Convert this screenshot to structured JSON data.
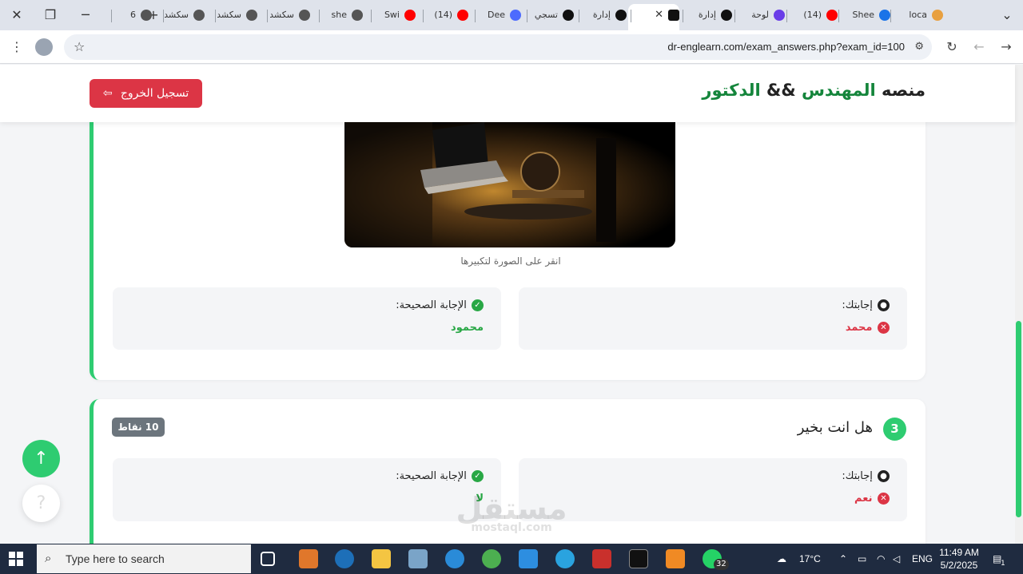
{
  "browser": {
    "tabs": [
      {
        "label": "loca",
        "color": "#e8a040"
      },
      {
        "label": "Shee",
        "color": "#1a73e8"
      },
      {
        "label": "(14)",
        "color": "#ff0000"
      },
      {
        "label": "لوحة",
        "color": "#6a3de8"
      },
      {
        "label": "إدارة",
        "color": "#111111"
      },
      {
        "label": "",
        "color": "#111111"
      },
      {
        "label": "إدارة",
        "color": "#111111"
      },
      {
        "label": "تسجي",
        "color": "#111111"
      },
      {
        "label": "Dee",
        "color": "#4d6bfe"
      },
      {
        "label": "(14)",
        "color": "#ff0000"
      },
      {
        "label": "Swi",
        "color": "#ff0000"
      },
      {
        "label": "she",
        "color": "#555555"
      },
      {
        "label": "سكشد",
        "color": "#555555"
      },
      {
        "label": "سكشد",
        "color": "#555555"
      },
      {
        "label": "سكشد",
        "color": "#555555"
      },
      {
        "label": "6",
        "color": "#555555"
      }
    ],
    "url": "dr-englearn.com/exam_answers.php?exam_id=100"
  },
  "site": {
    "brand_prefix": "منصه",
    "brand_engineer": "المهندس",
    "brand_and": "&&",
    "brand_doctor": "الدكتور",
    "logout_label": "تسجيل الخروج"
  },
  "question2": {
    "image_caption": "انقر على الصورة لتكبيرها",
    "your_answer_label": "إجابتك:",
    "your_answer_value": "محمد",
    "correct_answer_label": "الإجابة الصحيحة:",
    "correct_answer_value": "محمود"
  },
  "question3": {
    "number": "3",
    "title": "هل انت بخير",
    "points": "10 نقاط",
    "your_answer_label": "إجابتك:",
    "your_answer_value": "نعم",
    "correct_answer_label": "الإجابة الصحيحة:",
    "correct_answer_value": "لا"
  },
  "watermark": {
    "text": "مستقل",
    "sub": "mostaql.com"
  },
  "taskbar": {
    "search_placeholder": "Type here to search",
    "whatsapp_badge": "32",
    "temperature": "17°C",
    "language": "ENG",
    "time": "11:49 AM",
    "date": "5/2/2025",
    "notification_count": "1"
  },
  "colors": {
    "accent": "#2ecc71",
    "danger": "#dc3545",
    "brand_green": "#14853b"
  }
}
